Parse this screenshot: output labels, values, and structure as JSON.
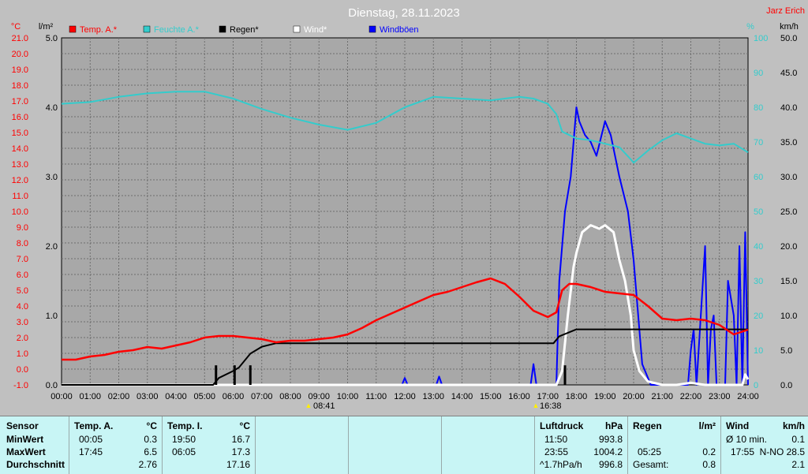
{
  "title": "Dienstag, 28.11.2023",
  "author": "Jarz Erich",
  "axes": {
    "temp_unit": "°C",
    "rain_unit": "l/m²",
    "hum_unit": "%",
    "wind_unit": "km/h",
    "temp_ticks": [
      "21.0",
      "20.0",
      "19.0",
      "18.0",
      "17.0",
      "16.0",
      "15.0",
      "14.0",
      "13.0",
      "12.0",
      "11.0",
      "10.0",
      "9.0",
      "8.0",
      "7.0",
      "6.0",
      "5.0",
      "4.0",
      "3.0",
      "2.0",
      "1.0",
      "0.0",
      "-1.0"
    ],
    "rain_ticks": [
      "5.0",
      "4.0",
      "3.0",
      "2.0",
      "1.0",
      "0.0"
    ],
    "hum_ticks": [
      "100",
      "90",
      "80",
      "70",
      "60",
      "50",
      "40",
      "30",
      "20",
      "10",
      "0"
    ],
    "wind_ticks": [
      "50.0",
      "45.0",
      "40.0",
      "35.0",
      "30.0",
      "25.0",
      "20.0",
      "15.0",
      "10.0",
      "5.0",
      "0.0"
    ],
    "time_ticks": [
      "00:00",
      "01:00",
      "02:00",
      "03:00",
      "04:00",
      "05:00",
      "06:00",
      "07:00",
      "08:00",
      "09:00",
      "10:00",
      "11:00",
      "12:00",
      "13:00",
      "14:00",
      "15:00",
      "16:00",
      "17:00",
      "18:00",
      "19:00",
      "20:00",
      "21:00",
      "22:00",
      "23:00",
      "24:00"
    ],
    "sunrise": "08:41",
    "sunset": "16:38"
  },
  "colors": {
    "temp": "#ff0000",
    "hum": "#33cccc",
    "rain": "#000000",
    "wind": "#ffffff",
    "gust": "#0000ff",
    "plot_bg": "#a8a8a8",
    "grid": "#6e6e6e",
    "temp_axis": "#ff0000",
    "hum_axis": "#33cccc"
  },
  "chart_data": {
    "type": "line",
    "title": "Dienstag, 28.11.2023",
    "x_unit": "hours",
    "series": [
      {
        "name": "Temp. A.*",
        "axis": "temp",
        "points": [
          [
            0,
            0.6
          ],
          [
            0.5,
            0.6
          ],
          [
            1,
            0.8
          ],
          [
            1.5,
            0.9
          ],
          [
            2,
            1.1
          ],
          [
            2.5,
            1.2
          ],
          [
            3,
            1.4
          ],
          [
            3.5,
            1.3
          ],
          [
            4,
            1.5
          ],
          [
            4.5,
            1.7
          ],
          [
            5,
            2.0
          ],
          [
            5.5,
            2.1
          ],
          [
            6,
            2.1
          ],
          [
            6.5,
            2.0
          ],
          [
            7,
            1.9
          ],
          [
            7.5,
            1.7
          ],
          [
            8,
            1.8
          ],
          [
            8.5,
            1.8
          ],
          [
            9,
            1.9
          ],
          [
            9.5,
            2.0
          ],
          [
            10,
            2.2
          ],
          [
            10.5,
            2.6
          ],
          [
            11,
            3.1
          ],
          [
            11.5,
            3.5
          ],
          [
            12,
            3.9
          ],
          [
            12.5,
            4.3
          ],
          [
            13,
            4.7
          ],
          [
            13.5,
            4.9
          ],
          [
            14,
            5.2
          ],
          [
            14.5,
            5.5
          ],
          [
            15,
            5.75
          ],
          [
            15.5,
            5.4
          ],
          [
            16,
            4.6
          ],
          [
            16.5,
            3.7
          ],
          [
            17,
            3.3
          ],
          [
            17.3,
            3.6
          ],
          [
            17.5,
            5.0
          ],
          [
            17.75,
            5.4
          ],
          [
            18,
            5.4
          ],
          [
            18.5,
            5.2
          ],
          [
            19,
            4.9
          ],
          [
            19.5,
            4.8
          ],
          [
            20,
            4.7
          ],
          [
            20.5,
            4.0
          ],
          [
            21,
            3.2
          ],
          [
            21.5,
            3.1
          ],
          [
            22,
            3.2
          ],
          [
            22.5,
            3.1
          ],
          [
            23,
            2.8
          ],
          [
            23.5,
            2.2
          ],
          [
            24,
            2.5
          ]
        ]
      },
      {
        "name": "Feuchte A.*",
        "axis": "hum",
        "points": [
          [
            0,
            81
          ],
          [
            1,
            81.5
          ],
          [
            2,
            83
          ],
          [
            3,
            84
          ],
          [
            4,
            84.5
          ],
          [
            5,
            84.5
          ],
          [
            6,
            82.5
          ],
          [
            7,
            79.5
          ],
          [
            8,
            77
          ],
          [
            9,
            75
          ],
          [
            10,
            73.5
          ],
          [
            11,
            75.5
          ],
          [
            12,
            80
          ],
          [
            13,
            83
          ],
          [
            14,
            82.5
          ],
          [
            15,
            82
          ],
          [
            16,
            83
          ],
          [
            16.5,
            82.5
          ],
          [
            17,
            81
          ],
          [
            17.3,
            78
          ],
          [
            17.5,
            73
          ],
          [
            18,
            71
          ],
          [
            18.5,
            70.5
          ],
          [
            19,
            69.5
          ],
          [
            19.5,
            68.5
          ],
          [
            19.9,
            65
          ],
          [
            20,
            64
          ],
          [
            20.5,
            67.5
          ],
          [
            21,
            70.5
          ],
          [
            21.5,
            72.5
          ],
          [
            22,
            71
          ],
          [
            22.5,
            69.5
          ],
          [
            23,
            69
          ],
          [
            23.5,
            69.5
          ],
          [
            24,
            67
          ]
        ]
      },
      {
        "name": "Regen*",
        "axis": "rain",
        "points": [
          [
            0,
            0
          ],
          [
            5.3,
            0
          ],
          [
            5.5,
            0.1
          ],
          [
            6,
            0.2
          ],
          [
            6.2,
            0.25
          ],
          [
            6.6,
            0.45
          ],
          [
            7,
            0.55
          ],
          [
            7.5,
            0.6
          ],
          [
            9,
            0.6
          ],
          [
            17.2,
            0.6
          ],
          [
            17.4,
            0.7
          ],
          [
            18,
            0.8
          ],
          [
            18.5,
            0.8
          ],
          [
            24,
            0.8
          ]
        ]
      },
      {
        "name": "Wind*",
        "axis": "wind",
        "points": [
          [
            0,
            0
          ],
          [
            17.3,
            0
          ],
          [
            17.5,
            2
          ],
          [
            17.7,
            10
          ],
          [
            17.9,
            17
          ],
          [
            18,
            19
          ],
          [
            18.2,
            22
          ],
          [
            18.5,
            23
          ],
          [
            18.8,
            22.5
          ],
          [
            19,
            23
          ],
          [
            19.3,
            22
          ],
          [
            19.5,
            18
          ],
          [
            19.7,
            15
          ],
          [
            19.9,
            10
          ],
          [
            20,
            5
          ],
          [
            20.2,
            2
          ],
          [
            20.5,
            0.5
          ],
          [
            21,
            0
          ],
          [
            21.5,
            0
          ],
          [
            22,
            0.3
          ],
          [
            22.5,
            0
          ],
          [
            23.8,
            0
          ],
          [
            23.9,
            1.5
          ],
          [
            24,
            0.8
          ]
        ]
      },
      {
        "name": "Windböen",
        "axis": "wind",
        "points": [
          [
            0,
            0
          ],
          [
            11.9,
            0
          ],
          [
            12,
            1
          ],
          [
            12.1,
            0
          ],
          [
            13.1,
            0
          ],
          [
            13.2,
            1.2
          ],
          [
            13.3,
            0
          ],
          [
            16.4,
            0
          ],
          [
            16.5,
            3
          ],
          [
            16.6,
            0
          ],
          [
            17.3,
            0
          ],
          [
            17.4,
            15
          ],
          [
            17.6,
            25
          ],
          [
            17.8,
            30
          ],
          [
            17.9,
            35
          ],
          [
            18,
            40
          ],
          [
            18.1,
            38
          ],
          [
            18.3,
            36
          ],
          [
            18.5,
            35
          ],
          [
            18.7,
            33
          ],
          [
            19,
            38
          ],
          [
            19.2,
            36
          ],
          [
            19.5,
            30
          ],
          [
            19.8,
            25
          ],
          [
            20,
            18
          ],
          [
            20.3,
            3
          ],
          [
            20.6,
            0
          ],
          [
            21.9,
            0
          ],
          [
            22,
            5
          ],
          [
            22.1,
            8
          ],
          [
            22.2,
            0
          ],
          [
            22.5,
            20
          ],
          [
            22.6,
            0
          ],
          [
            22.7,
            8
          ],
          [
            22.8,
            10
          ],
          [
            22.9,
            0
          ],
          [
            23.2,
            0
          ],
          [
            23.3,
            15
          ],
          [
            23.5,
            10
          ],
          [
            23.6,
            0
          ],
          [
            23.7,
            20
          ],
          [
            23.8,
            0
          ],
          [
            23.9,
            22
          ],
          [
            24,
            0
          ]
        ]
      }
    ]
  },
  "table": {
    "rows": [
      "Sensor",
      "MinWert",
      "MaxWert",
      "Durchschnitt"
    ],
    "temp_a": {
      "header": "Temp. A.",
      "unit": "°C",
      "min_time": "00:05",
      "min": "0.3",
      "max_time": "17:45",
      "max": "6.5",
      "avg": "2.76"
    },
    "temp_i": {
      "header": "Temp. I.",
      "unit": "°C",
      "min_time": "19:50",
      "min": "16.7",
      "max_time": "06:05",
      "max": "17.3",
      "avg": "17.16"
    },
    "press": {
      "header": "Luftdruck",
      "unit": "hPa",
      "min_time": "11:50",
      "min": "993.8",
      "max_time": "23:55",
      "max": "1004.2",
      "avg_label": "^1.7hPa/h",
      "avg": "996.8"
    },
    "rain": {
      "header": "Regen",
      "unit": "l/m²",
      "max_time": "05:25",
      "max": "0.2",
      "total_label": "Gesamt:",
      "total": "0.8"
    },
    "wind": {
      "header": "Wind",
      "unit": "km/h",
      "min_label": "Ø 10 min.",
      "min": "0.1",
      "max_time": "17:55",
      "max": "N-NO 28.5",
      "avg": "2.1"
    }
  }
}
